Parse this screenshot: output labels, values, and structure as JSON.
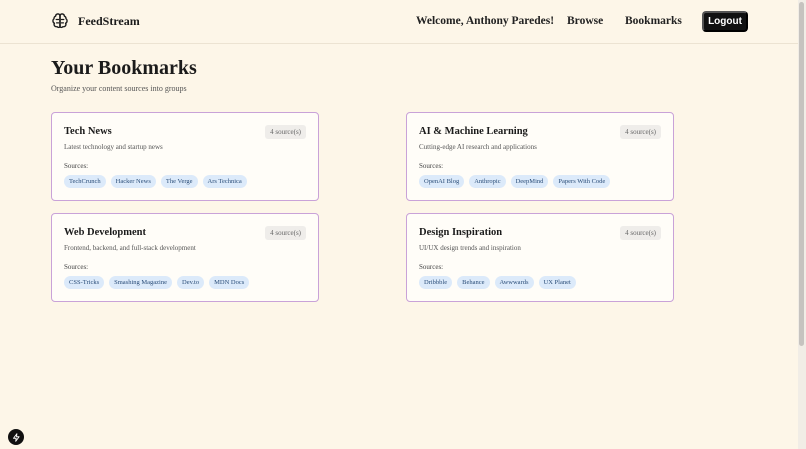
{
  "nav": {
    "brand": "FeedStream",
    "welcome": "Welcome, Anthony Paredes!",
    "browse": "Browse",
    "bookmarks": "Bookmarks",
    "logout": "Logout"
  },
  "header": {
    "title": "Your Bookmarks",
    "subtitle": "Organize your content sources into groups"
  },
  "groups": [
    {
      "title": "Tech News",
      "description": "Latest technology and startup news",
      "count": "4 source(s)",
      "sources_label": "Sources:",
      "sources": [
        "TechCrunch",
        "Hacker News",
        "The Verge",
        "Ars Technica"
      ]
    },
    {
      "title": "AI & Machine Learning",
      "description": "Cutting-edge AI research and applications",
      "count": "4 source(s)",
      "sources_label": "Sources:",
      "sources": [
        "OpenAI Blog",
        "Anthropic",
        "DeepMind",
        "Papers With Code"
      ]
    },
    {
      "title": "Web Development",
      "description": "Frontend, backend, and full-stack development",
      "count": "4 source(s)",
      "sources_label": "Sources:",
      "sources": [
        "CSS-Tricks",
        "Smashing Magazine",
        "Dev.to",
        "MDN Docs"
      ]
    },
    {
      "title": "Design Inspiration",
      "description": "UI/UX design trends and inspiration",
      "count": "4 source(s)",
      "sources_label": "Sources:",
      "sources": [
        "Dribbble",
        "Behance",
        "Awwwards",
        "UX Planet"
      ]
    }
  ],
  "colors": {
    "background": "#fdf6e8",
    "card_border": "#c9a2d8",
    "chip_bg": "#dceafa",
    "logout_bg": "#111111"
  },
  "icons": {
    "brand": "brain-icon",
    "dev_badge": "lightning-icon"
  }
}
